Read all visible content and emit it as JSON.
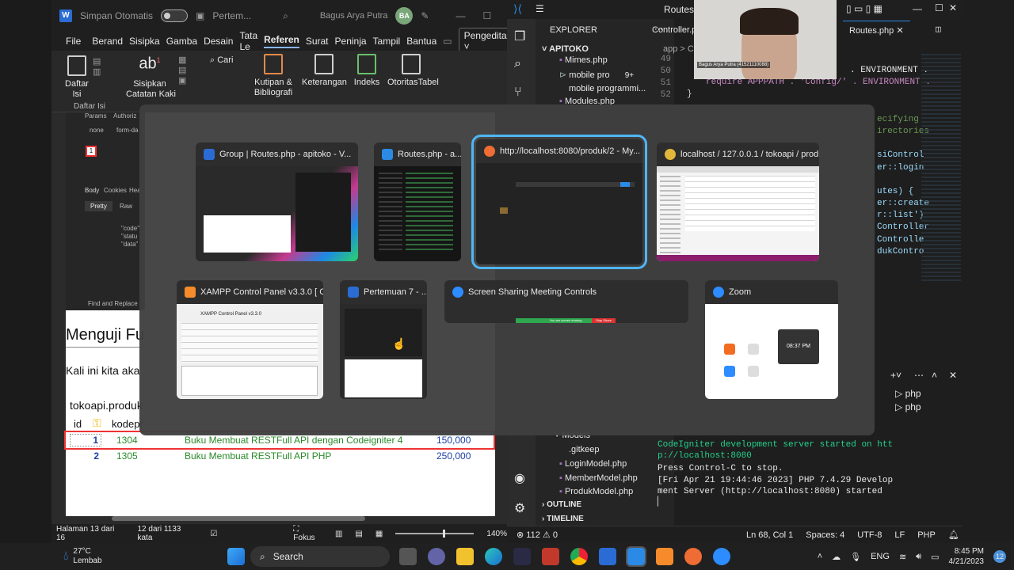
{
  "word": {
    "autosave_label": "Simpan Otomatis",
    "doc_name": "Pertem...",
    "user_name": "Bagus Arya Putra",
    "user_initials": "BA",
    "tabs": [
      "File",
      "Berand",
      "Sisipka",
      "Gamba",
      "Desain",
      "Tata Le",
      "Referen",
      "Surat",
      "Peninja",
      "Tampil",
      "Bantua"
    ],
    "active_tab": "Referen",
    "editing_button": "Pengeditan",
    "ribbon": {
      "toc_label": "Daftar\nIsi",
      "toc_group": "Daftar Isi",
      "footnote_label": "Sisipkan\nCatatan Kaki",
      "search_label": "Cari",
      "citation_label": "Kutipan &\nBibliografi",
      "caption_label": "Keterangan",
      "index_label": "Indeks",
      "authority_label": "OtoritasTabel"
    },
    "postman_snippet": {
      "tabs": [
        "Params",
        "Authoriz"
      ],
      "body_options": [
        "none",
        "form-da"
      ],
      "response_tabs": [
        "Body",
        "Cookies",
        "Hea"
      ],
      "view_modes": [
        "Pretty",
        "Raw"
      ],
      "lines": [
        "\"code\"",
        "\"statu",
        "\"data\""
      ],
      "find_replace": "Find and Replace",
      "badge": "1"
    },
    "heading": "Menguji Fu",
    "paragraph": "Kali ini kita aka",
    "table_title": "tokoapi.produk",
    "table_headers": [
      "id",
      "kodepr"
    ],
    "table_rows": [
      {
        "id": "1",
        "kode": "1304",
        "name": "Buku Membuat RESTFull API dengan Codeigniter 4",
        "price": "150,000"
      },
      {
        "id": "2",
        "kode": "1305",
        "name": "Buku Membuat RESTFull API PHP",
        "price": "250,000"
      }
    ],
    "status": {
      "page": "Halaman 13 dari 16",
      "words": "12 dari 1133 kata",
      "focus": "Fokus",
      "zoom": "140%"
    }
  },
  "vscode": {
    "title": "Routes.php",
    "explorer_title": "EXPLORER",
    "project": "APITOKO",
    "files": [
      "Mimes.php",
      "mobile pro",
      "mobile programmi...",
      "Modules.php"
    ],
    "mobile_badge": "9+",
    "tabs": [
      "Controller.php",
      "Routes.php"
    ],
    "breadcrumb": "app > Con",
    "line_numbers": [
      "49",
      "50",
      "51",
      "52"
    ],
    "code_lines": [
      ". ENVIRONMENT .",
      "require APPPATH . 'Config/' . ENVIRONMENT .",
      "}"
    ],
    "right_fragments": [
      "ecifying",
      "irectories",
      "siControl",
      "er::login",
      "utes) {",
      "er::create",
      "r::list')",
      "Controller",
      "Controlle",
      "dukContro"
    ],
    "models_tree": [
      "Models",
      ".gitkeep",
      "LoginModel.php",
      "MemberModel.php",
      "ProdukModel.php"
    ],
    "sections": [
      "OUTLINE",
      "TIMELINE"
    ],
    "terminal_lines": [
      "CodeIgniter development server started on htt",
      "p://localhost:8080",
      "Press Control-C to stop.",
      "[Fri Apr 21 19:44:46 2023] PHP 7.4.29 Develop",
      "ment Server (http://localhost:8080) started",
      "▏"
    ],
    "terminal_list": [
      "php",
      "php"
    ],
    "status": {
      "problems": "112",
      "warnings": "0",
      "position": "Ln 68, Col 1",
      "spaces": "Spaces: 4",
      "encoding": "UTF-8",
      "eol": "LF",
      "language": "PHP"
    }
  },
  "webcam": {
    "name": "Bagus Arya Putra (41521110088)"
  },
  "switcher": {
    "windows": [
      {
        "title": "Group | Routes.php - apitoko - V...",
        "icon": "vscode-word-icon",
        "color": "#2b6cd4"
      },
      {
        "title": "Routes.php - a...",
        "icon": "vscode-icon",
        "color": "#2b8ae6"
      },
      {
        "title": "http://localhost:8080/produk/2 - My...",
        "icon": "postman-icon",
        "color": "#ef6c35"
      },
      {
        "title": "localhost / 127.0.0.1 / tokoapi / produ...",
        "icon": "chrome-icon",
        "color": "#e2b63a"
      },
      {
        "title": "XAMPP Control Panel v3.3.0   [ C...",
        "icon": "xampp-icon",
        "color": "#f58b2b"
      },
      {
        "title": "Pertemuan 7 - ...",
        "icon": "word-icon",
        "color": "#2b6cd4"
      },
      {
        "title": "Screen Sharing Meeting Controls",
        "icon": "zoom-icon",
        "color": "#2d8cff"
      },
      {
        "title": "Zoom",
        "icon": "zoom-icon",
        "color": "#2d8cff"
      }
    ],
    "selected_index": 2,
    "zoom_clock": "08:37 PM",
    "xampp_heading": "XAMPP Control Panel v3.3.0",
    "share_bar": {
      "left": "You are screen sharing",
      "stop": "Stop Share"
    }
  },
  "taskbar": {
    "temperature": "27°C",
    "weather": "Lembab",
    "search": "Search",
    "language": "ENG",
    "time": "8:45 PM",
    "date": "4/21/2023",
    "notifications": "12"
  }
}
